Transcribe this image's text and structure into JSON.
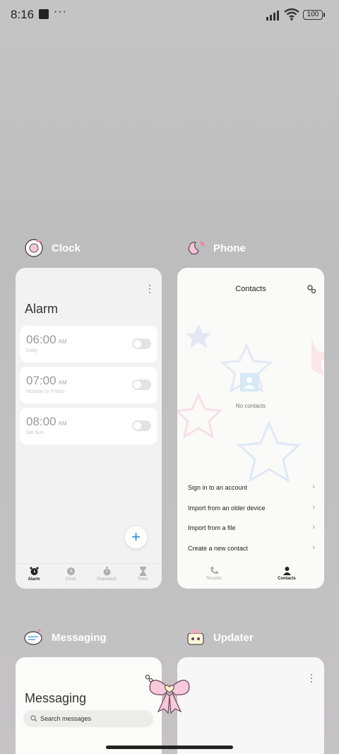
{
  "status_bar": {
    "time": "8:16",
    "more": "···",
    "battery": "100"
  },
  "apps": {
    "clock": {
      "name": "Clock",
      "title": "Alarm",
      "alarms": [
        {
          "time": "06:00",
          "ampm": "AM",
          "repeat": "Daily",
          "enabled": false
        },
        {
          "time": "07:00",
          "ampm": "AM",
          "repeat": "Monday to Friday",
          "enabled": false
        },
        {
          "time": "08:00",
          "ampm": "AM",
          "repeat": "Sat Sun",
          "enabled": false
        }
      ],
      "fab": "+",
      "nav": [
        "Alarm",
        "Clock",
        "Stopwatch",
        "Timer"
      ],
      "active_nav": "Alarm"
    },
    "phone": {
      "name": "Phone",
      "title": "Contacts",
      "empty_text": "No contacts",
      "options": [
        "Sign in to an account",
        "Import from an older device",
        "Import from a file",
        "Create a new contact"
      ],
      "nav": [
        "Recents",
        "Contacts"
      ],
      "active_nav": "Contacts"
    },
    "messaging": {
      "name": "Messaging",
      "title": "Messaging",
      "search_label": "Search messages"
    },
    "updater": {
      "name": "Updater"
    }
  },
  "icons": {
    "status": [
      "notification-square-icon",
      "cellular-signal-icon",
      "wifi-icon",
      "battery-icon"
    ],
    "clock_nav": [
      "alarm-icon",
      "clock-icon",
      "stopwatch-icon",
      "hourglass-icon"
    ],
    "phone_nav": [
      "phone-handset-icon",
      "person-icon"
    ],
    "other": [
      "settings-gear-icon",
      "more-vertical-icon",
      "search-icon",
      "ribbon-bow-icon"
    ]
  },
  "colors": {
    "accent": "#1a8ce0",
    "background": "#c2c2c2",
    "app_label": "#ffffff"
  }
}
